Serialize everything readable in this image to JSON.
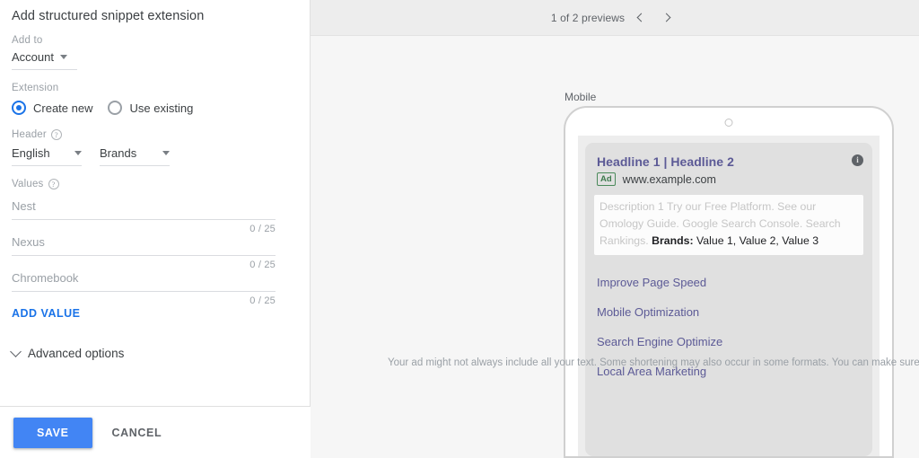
{
  "panel": {
    "title": "Add structured snippet extension",
    "add_to": {
      "label": "Add to",
      "value": "Account"
    },
    "extension": {
      "label": "Extension",
      "options": [
        {
          "label": "Create new",
          "selected": true
        },
        {
          "label": "Use existing",
          "selected": false
        }
      ]
    },
    "header": {
      "label": "Header",
      "help_glyph": "?",
      "language": "English",
      "type": "Brands"
    },
    "values": {
      "label": "Values",
      "help_glyph": "?",
      "items": [
        {
          "placeholder": "Nest",
          "value": "",
          "counter": "0 / 25"
        },
        {
          "placeholder": "Nexus",
          "value": "",
          "counter": "0 / 25"
        },
        {
          "placeholder": "Chromebook",
          "value": "",
          "counter": "0 / 25"
        }
      ],
      "add_value_label": "ADD VALUE"
    },
    "advanced_options_label": "Advanced options",
    "footer": {
      "save_label": "SAVE",
      "cancel_label": "CANCEL"
    }
  },
  "preview": {
    "count_text": "1 of 2 previews",
    "device_label": "Mobile",
    "ad": {
      "headline": "Headline 1 | Headline 2",
      "ad_badge": "Ad",
      "url": "www.example.com",
      "info_glyph": "i",
      "description_faded": "Description 1 Try our Free Platform. See our Omology Guide. Google Search Console. Search Rankings.",
      "snippet_header": "Brands:",
      "snippet_values": "Value 1, Value 2, Value 3",
      "sitelinks": [
        "Improve Page Speed",
        "Mobile Optimization",
        "Search Engine Optimize",
        "Local Area Marketing"
      ]
    },
    "disclaimer": "Your ad might not always include all your text. Some shortening may also occur in some formats. You can make sure certain"
  },
  "colors": {
    "accent_blue": "#1a73e8",
    "save_blue": "#4285f4",
    "link_purple": "#5c5a96",
    "ad_green": "#3d7a4d"
  }
}
